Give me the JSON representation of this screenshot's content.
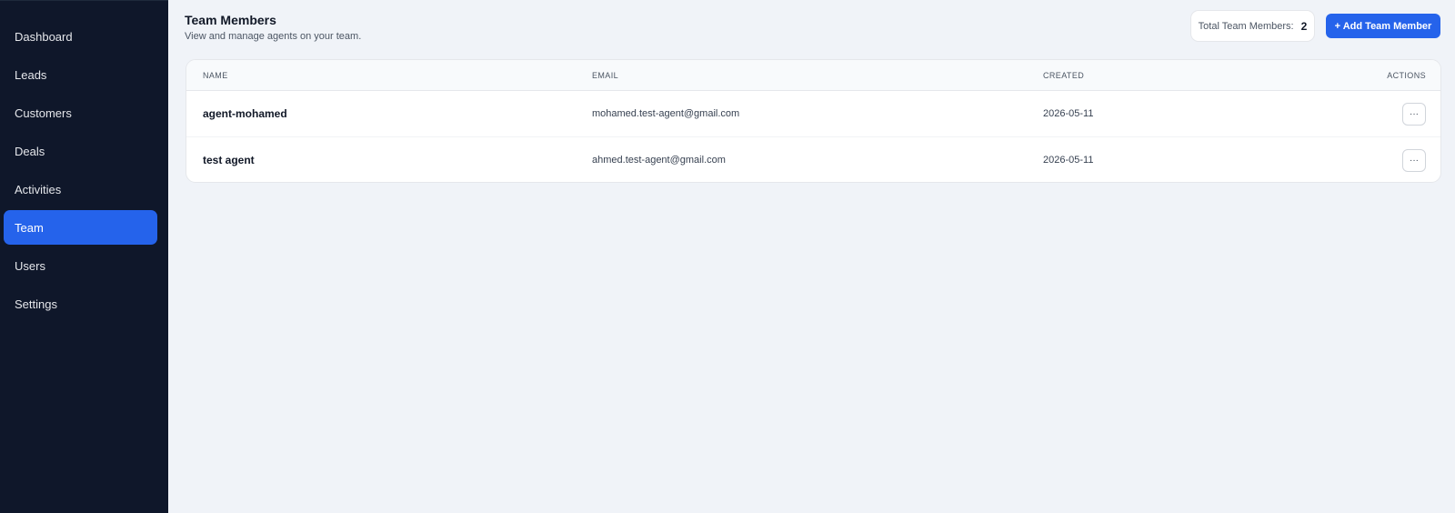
{
  "sidebar": {
    "items": [
      {
        "label": "Dashboard",
        "active": false
      },
      {
        "label": "Leads",
        "active": false
      },
      {
        "label": "Customers",
        "active": false
      },
      {
        "label": "Deals",
        "active": false
      },
      {
        "label": "Activities",
        "active": false
      },
      {
        "label": "Team",
        "active": true
      },
      {
        "label": "Users",
        "active": false
      },
      {
        "label": "Settings",
        "active": false
      }
    ]
  },
  "header": {
    "title": "Team Members",
    "subtitle": "View and manage agents on your team.",
    "count_label": "Total Team Members:",
    "count_value": "2",
    "add_button_label": "+ Add Team Member"
  },
  "table": {
    "columns": {
      "name": "NAME",
      "email": "EMAIL",
      "created": "CREATED",
      "actions": "ACTIONS"
    },
    "rows": [
      {
        "name": "agent-mohamed",
        "email": "mohamed.test-agent@gmail.com",
        "created": "2026-05-11",
        "action_icon": "ellipsis-icon",
        "action_glyph": "···"
      },
      {
        "name": "test agent",
        "email": "ahmed.test-agent@gmail.com",
        "created": "2026-05-11",
        "action_icon": "ellipsis-icon",
        "action_glyph": "···"
      }
    ]
  },
  "colors": {
    "sidebar_bg": "#0f172a",
    "accent": "#2563eb",
    "page_bg": "#f0f3f8"
  }
}
